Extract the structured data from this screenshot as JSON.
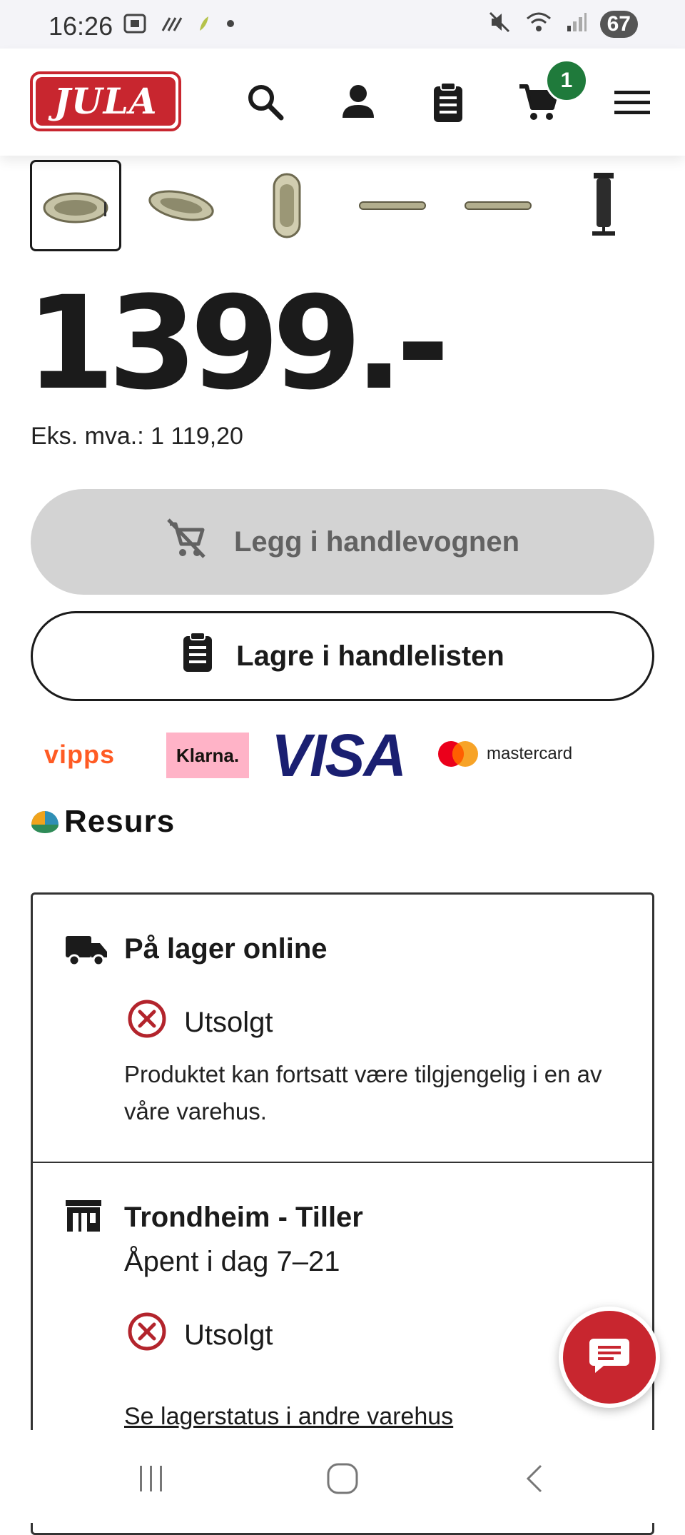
{
  "status_bar": {
    "time": "16:26",
    "battery": "67"
  },
  "header": {
    "logo_text": "JULA",
    "cart_count": "1",
    "colors": {
      "brand": "#c8262f",
      "badge": "#1f7a3b"
    }
  },
  "thumbnails": [
    {
      "name": "boat-angle-1",
      "selected": true
    },
    {
      "name": "boat-angle-2",
      "selected": false
    },
    {
      "name": "boat-top",
      "selected": false
    },
    {
      "name": "boat-side-1",
      "selected": false
    },
    {
      "name": "boat-side-2",
      "selected": false
    },
    {
      "name": "pump",
      "selected": false
    }
  ],
  "product": {
    "price": "1399.-",
    "ex_vat": "Eks. mva.: 1 119,20"
  },
  "actions": {
    "add_to_cart": "Legg i handlevognen",
    "save_to_list": "Lagre i handlelisten"
  },
  "payments": {
    "vipps": "vipps",
    "klarna": "Klarna.",
    "visa": "VISA",
    "mastercard": "mastercard",
    "resurs": "Resurs"
  },
  "stock": {
    "online": {
      "title": "På lager online",
      "status": "Utsolgt",
      "note": "Produktet kan fortsatt være tilgjengelig i en av våre varehus."
    },
    "store": {
      "name": "Trondheim - Tiller",
      "hours": "Åpent i dag 7–21",
      "status": "Utsolgt",
      "link": "Se lagerstatus i andre varehus"
    }
  }
}
